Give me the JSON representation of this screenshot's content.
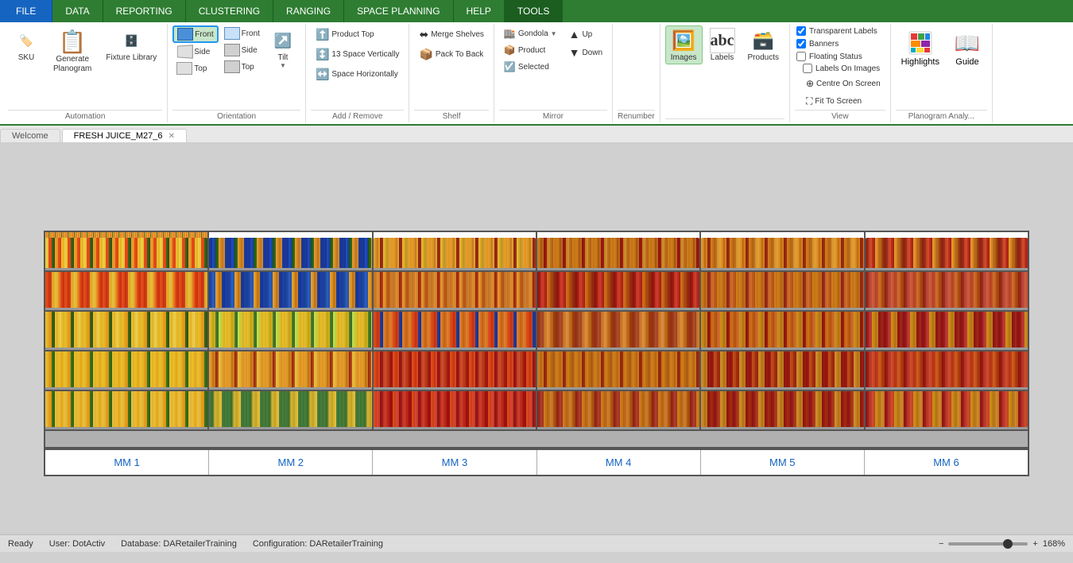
{
  "ribbon": {
    "tabs": [
      {
        "id": "file",
        "label": "FILE",
        "active": false,
        "isFile": true
      },
      {
        "id": "data",
        "label": "DATA",
        "active": false
      },
      {
        "id": "reporting",
        "label": "REPORTING",
        "active": false
      },
      {
        "id": "clustering",
        "label": "CLUSTERING",
        "active": false
      },
      {
        "id": "ranging",
        "label": "RANGING",
        "active": false
      },
      {
        "id": "space_planning",
        "label": "SPACE PLANNING",
        "active": false
      },
      {
        "id": "help",
        "label": "HELP",
        "active": false
      },
      {
        "id": "tools",
        "label": "TOOLS",
        "active": true
      }
    ],
    "groups": {
      "automation": {
        "label": "Automation",
        "sku_label": "SKU",
        "fixture_label": "Fixture Library",
        "generate_label": "Generate\nPlanogram"
      },
      "orientation": {
        "label": "Orientation",
        "front_active": true,
        "btn1_front": "Front",
        "btn2_front": "Front",
        "btn1_side": "Side",
        "btn2_side": "Side",
        "btn1_top": "Top",
        "btn2_top": "Top",
        "tilt": "Tilt"
      },
      "add_remove": {
        "label": "Add / Remove",
        "product_top": "Product Top",
        "space_vertically": "Space Vertically",
        "space_horizontally": "Space Horizontally"
      },
      "shelf": {
        "label": "Shelf",
        "merge_shelves": "Merge Shelves",
        "pack_to_back": "Pack To Back"
      },
      "mirror": {
        "label": "Mirror",
        "gondola": "Gondola",
        "product": "Product",
        "selected": "Selected",
        "up": "Up",
        "down": "Down"
      },
      "renumber": {
        "label": "Renumber"
      },
      "images": {
        "label": "",
        "images": "Images",
        "labels": "Labels",
        "products": "Products"
      },
      "view": {
        "label": "View",
        "transparent_labels": "Transparent Labels",
        "banners": "Banners",
        "floating_status": "Floating Status",
        "labels_on_images": "Labels On Images",
        "centre_on_screen": "Centre On Screen",
        "fit_to_screen": "Fit To Screen"
      },
      "planogram_analysis": {
        "label": "Planogram Analy...",
        "highlights": "Highlights",
        "guide": "Guide"
      }
    }
  },
  "doc_tabs": [
    {
      "label": "Welcome",
      "active": false,
      "closeable": false
    },
    {
      "label": "FRESH JUICE_M27_6",
      "active": true,
      "closeable": true
    }
  ],
  "planogram": {
    "mm_labels": [
      "MM 1",
      "MM 2",
      "MM 3",
      "MM 4",
      "MM 5",
      "MM 6"
    ],
    "shelf_rows": 5,
    "units": 6
  },
  "status_bar": {
    "status": "Ready",
    "user_label": "User:",
    "user": "DotActiv",
    "database_label": "Database:",
    "database": "DARetailerTraining",
    "configuration_label": "Configuration:",
    "configuration": "DARetailerTraining",
    "zoom": "168%"
  }
}
